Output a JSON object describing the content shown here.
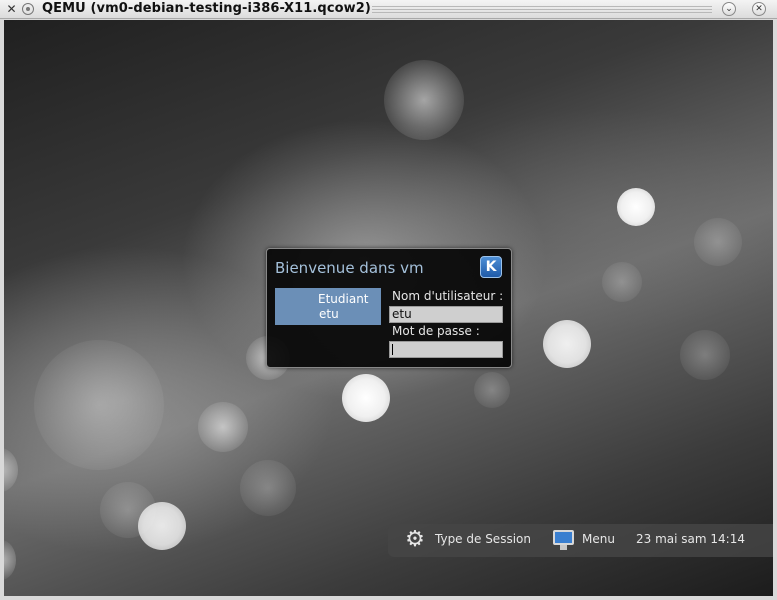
{
  "window": {
    "title": "QEMU (vm0-debian-testing-i386-X11.qcow2)"
  },
  "login_dialog": {
    "title": "Bienvenue dans vm",
    "logo_icon": "kde-logo-icon",
    "user": {
      "full_name": "Etudiant",
      "login": "etu"
    },
    "username_label": "Nom d'utilisateur :",
    "username_value": "etu",
    "password_label": "Mot de passe :",
    "password_value": ""
  },
  "panel": {
    "session_label": "Type de Session",
    "session_icon": "gear-icon",
    "menu_label": "Menu",
    "menu_icon": "monitor-icon",
    "clock": "23 mai sam 14:14"
  },
  "colors": {
    "dialog_title": "#a4c0da",
    "user_tile": "#6b8fb7",
    "input_bg": "#cfcfcf"
  }
}
